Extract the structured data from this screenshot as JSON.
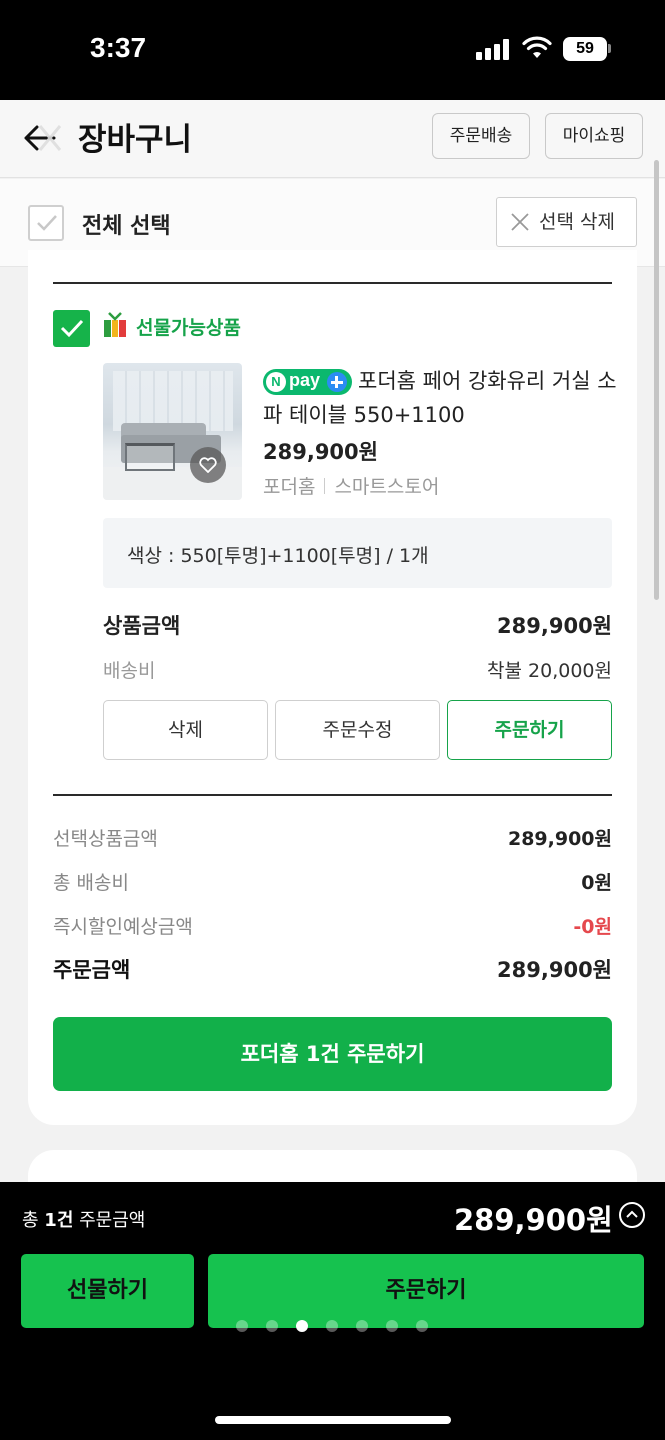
{
  "status_bar": {
    "time": "3:37",
    "battery": "59"
  },
  "header": {
    "title": "장바구니",
    "orders_label": "주문배송",
    "myshop_label": "마이쇼핑"
  },
  "select_bar": {
    "select_all_label": "전체 선택",
    "delete_selected_label": "선택 삭제"
  },
  "item": {
    "gift_label": "선물가능상품",
    "npay_text": "pay",
    "name": "포더홈 페어 강화유리 거실 소파 테이블 550+1100",
    "price": "289,900원",
    "store": "포더홈",
    "store_type": "스마트스토어",
    "option": "색상 : 550[투명]+1100[투명] / 1개",
    "product_amount_label": "상품금액",
    "product_amount": "289,900원",
    "shipping_label": "배송비",
    "shipping": "착불 20,000원",
    "delete_label": "삭제",
    "edit_label": "주문수정",
    "order_label": "주문하기"
  },
  "summary": {
    "selected_label": "선택상품금액",
    "selected_value": "289,900원",
    "shipping_label": "총 배송비",
    "shipping_value": "0원",
    "discount_label": "즉시할인예상금액",
    "discount_value": "-0원",
    "order_total_label": "주문금액",
    "order_total_value": "289,900원",
    "cta_label": "포더홈  1건 주문하기"
  },
  "bottom": {
    "total_prefix": "총",
    "total_count": "1건",
    "total_suffix": "주문금액",
    "total_amount": "289,900원",
    "gift_button": "선물하기",
    "order_button": "주문하기"
  },
  "pager": {
    "count": 7,
    "active": 3
  },
  "colors": {
    "accent": "#16b34a",
    "cta": "#12b04a",
    "bottom_button": "#16c24f",
    "discount": "#e5484d",
    "npay": "#0bb86e"
  },
  "icons": [
    "back-arrow-icon",
    "checkbox-icon",
    "close-icon",
    "gift-icon",
    "heart-icon",
    "chevron-up-icon"
  ]
}
